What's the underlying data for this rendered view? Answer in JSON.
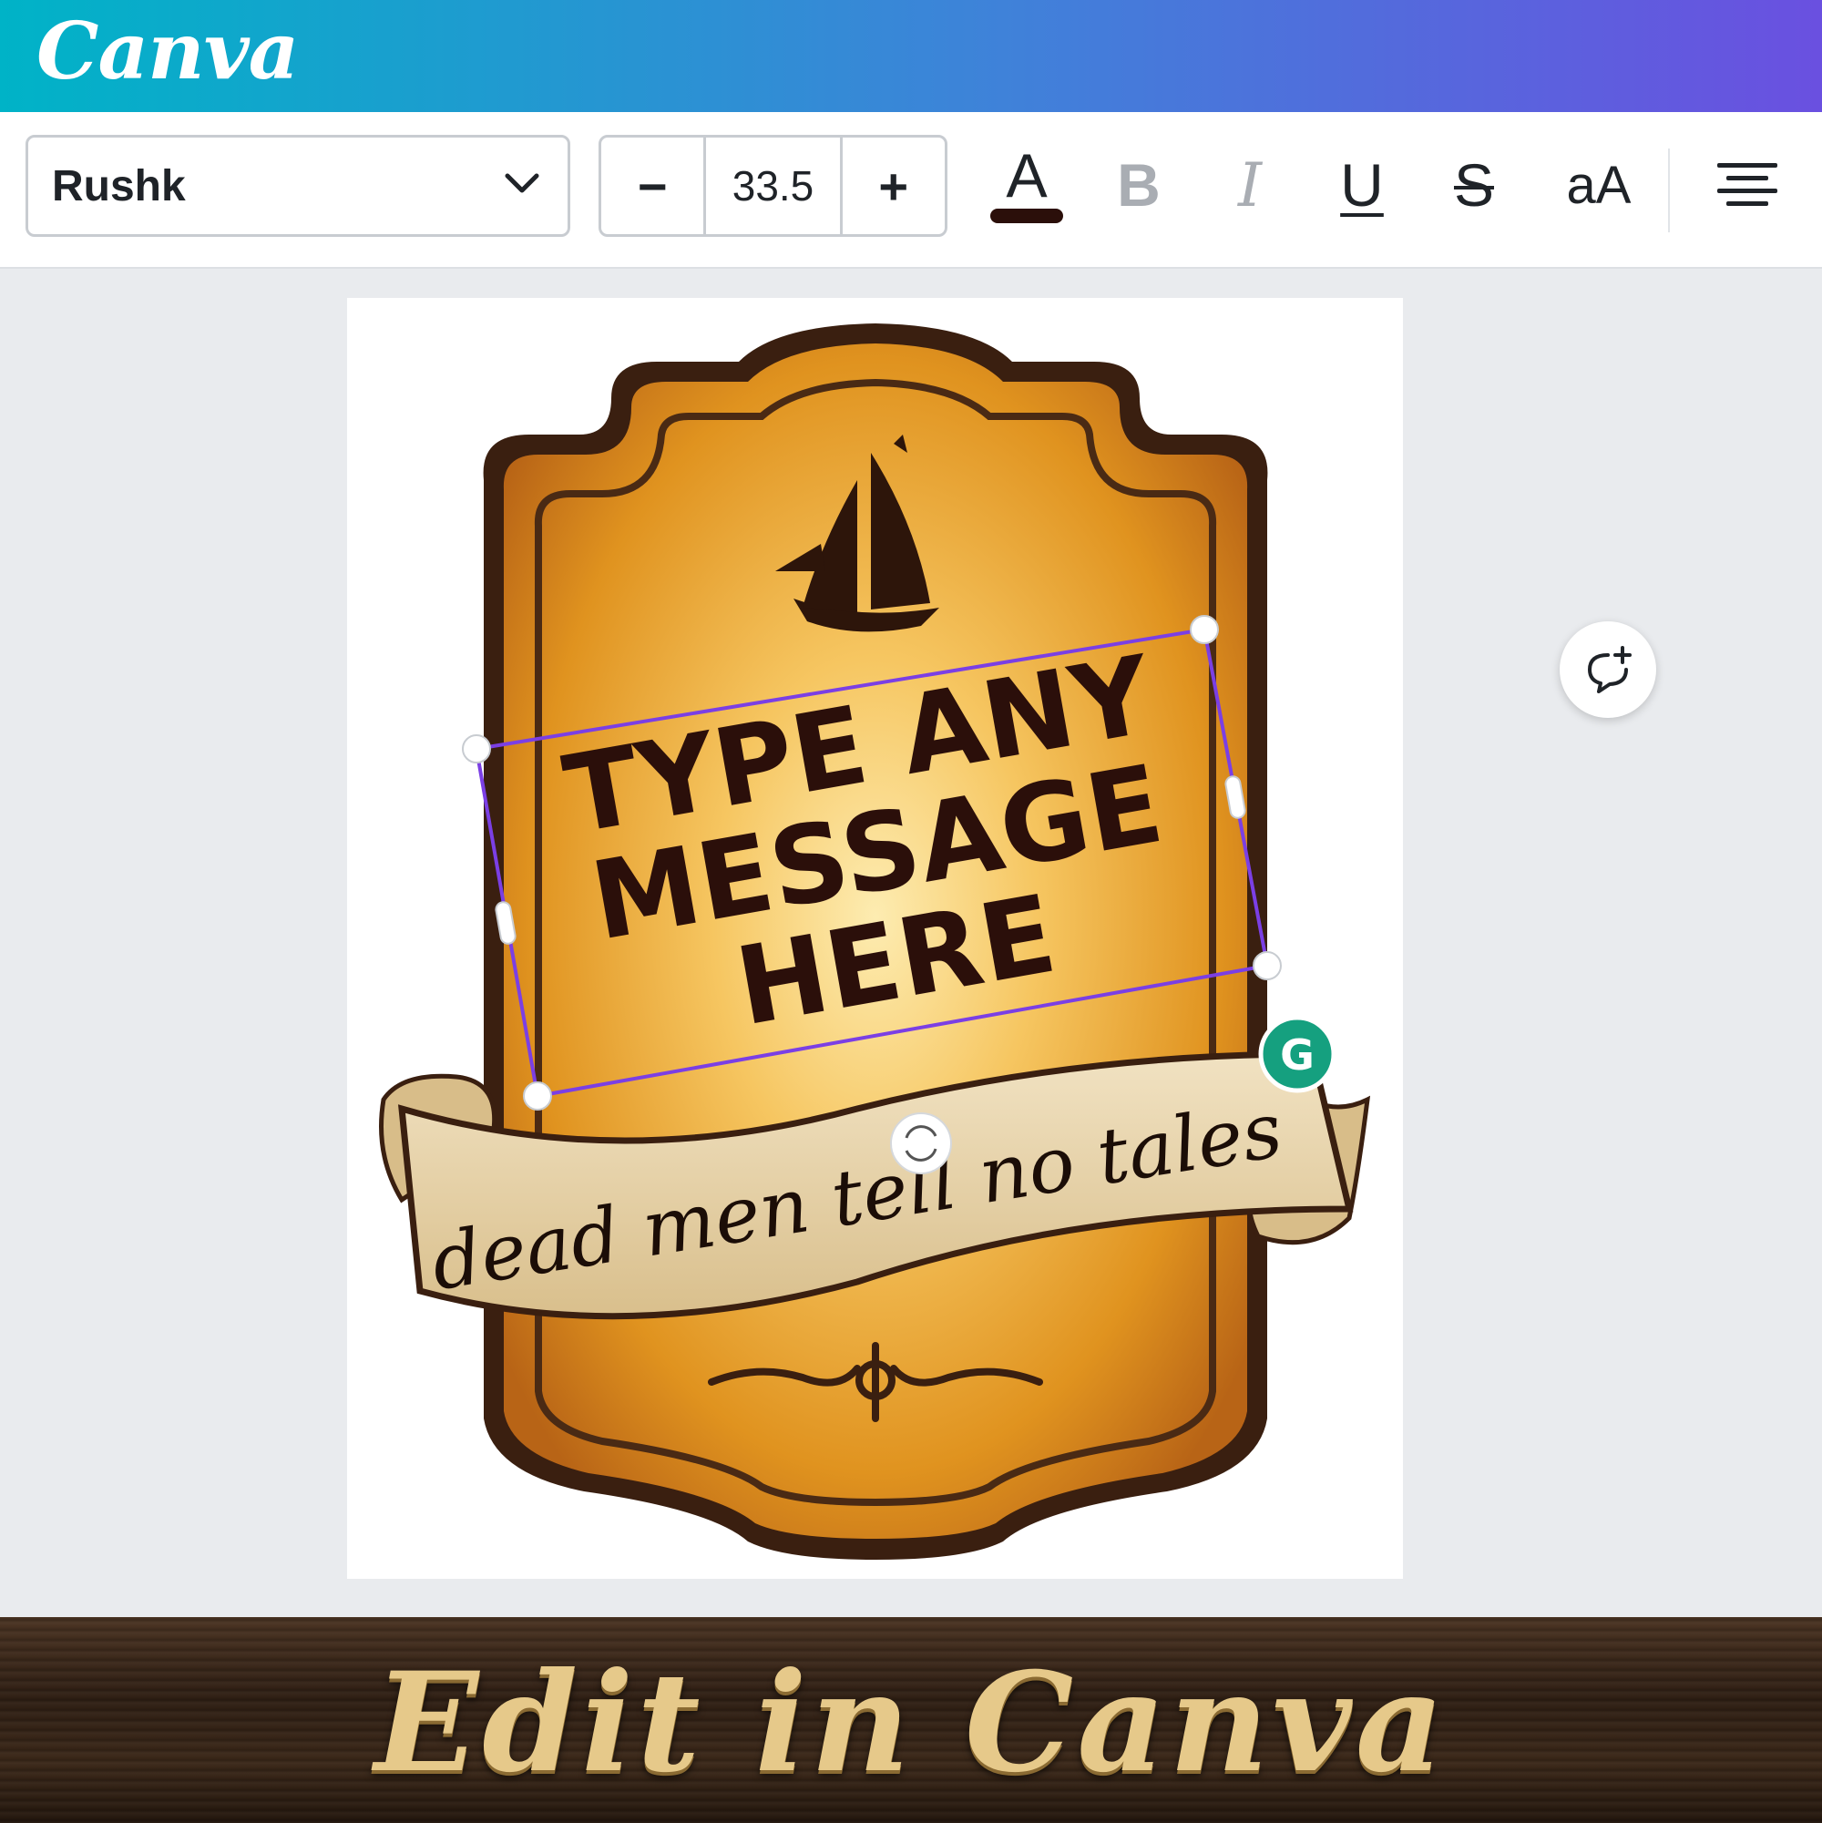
{
  "app": {
    "logo_text": "Canva"
  },
  "toolbar": {
    "font_name": "Rushk",
    "font_size": "33.5",
    "decrease_label": "−",
    "increase_label": "+",
    "text_color_glyph": "A",
    "bold_glyph": "B",
    "italic_glyph": "I",
    "underline_glyph": "U",
    "strikethrough_glyph": "S",
    "case_glyph": "aA",
    "text_color": "#2b0f0a",
    "icons": [
      "chevron-down-icon",
      "align-center-icon"
    ]
  },
  "design": {
    "headline_lines": [
      "TYPE ANY",
      "MESSAGE",
      "HERE"
    ],
    "banner_text": "dead men tell no tales",
    "selection_color": "#7b3fe4",
    "label_colors": {
      "outer_border": "#3a1f10",
      "fill_light": "#f9d98a",
      "fill_dark": "#c9731d",
      "banner": "#ead7b0"
    }
  },
  "footer": {
    "title": "Edit in Canva"
  }
}
